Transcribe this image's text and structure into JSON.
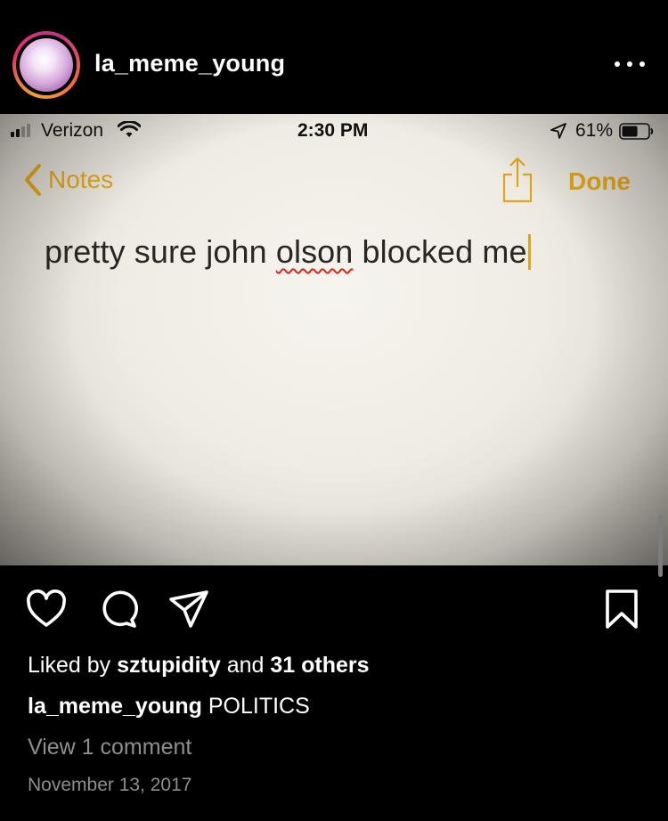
{
  "post": {
    "username": "la_meme_young",
    "liked_by_prefix": "Liked by",
    "liked_by_user": "sztupidity",
    "liked_by_and": "and",
    "liked_by_others": "31 others",
    "caption_user": "la_meme_young",
    "caption_text": "POLITICS",
    "view_comments": "View 1 comment",
    "date": "November 13, 2017"
  },
  "screenshot": {
    "status_bar": {
      "carrier": "Verizon",
      "time": "2:30 PM",
      "battery": "61%",
      "battery_level": 0.61
    },
    "notes_nav": {
      "back_label": "Notes",
      "done_label": "Done"
    },
    "note": {
      "text_before": "pretty sure john ",
      "misspelled": "olson",
      "text_after": " blocked me"
    }
  },
  "colors": {
    "accent": "#e2a41b",
    "background": "#000000",
    "secondary_text": "#8e8e8e",
    "spellcheck": "#d0281c"
  },
  "icons": [
    "more-icon",
    "heart-icon",
    "comment-icon",
    "send-icon",
    "bookmark-icon",
    "chevron-left-icon",
    "share-icon",
    "wifi-icon",
    "location-icon",
    "battery-icon"
  ]
}
